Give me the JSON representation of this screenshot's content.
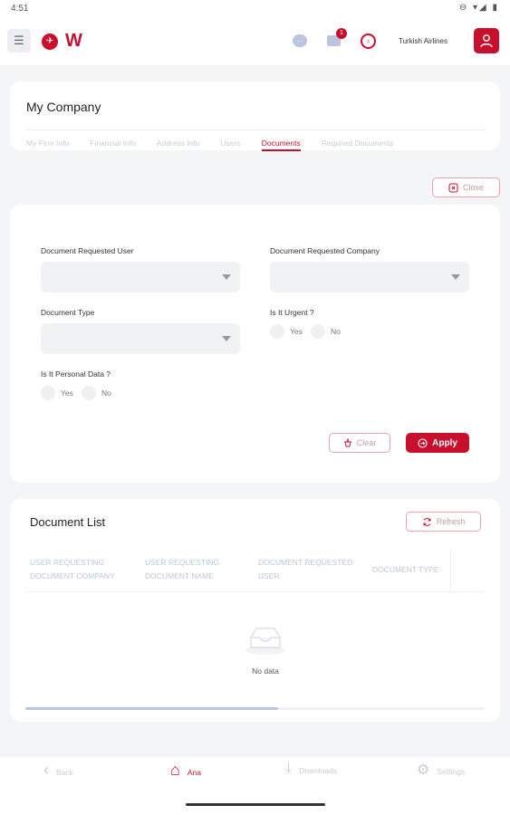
{
  "status": {
    "time": "4:51",
    "icons": "⊖ ▾◢ ▮"
  },
  "topbar": {
    "menu_icon": "☰",
    "logo_mark": "✈",
    "logo_text": "W",
    "chat_icon": "…",
    "notification_count": "1",
    "globe_icon": "♁",
    "company_name": "Turkish Airlines"
  },
  "company": {
    "title": "My Company",
    "tabs": [
      {
        "label": "My Firm Info"
      },
      {
        "label": "Financial Info"
      },
      {
        "label": "Address Info"
      },
      {
        "label": "Users"
      },
      {
        "label": "Documents"
      },
      {
        "label": "Required Documents"
      }
    ],
    "active_tab": "Documents"
  },
  "close_button": "Close",
  "filters": {
    "requested_user_label": "Document Requested User",
    "requested_company_label": "Document Requested Company",
    "type_label": "Document Type",
    "urgent_label": "Is It Urgent ?",
    "personal_label": "Is It Personal Data ?",
    "yes": "Yes",
    "no": "No",
    "clear_button": "Clear",
    "apply_button": "Apply"
  },
  "document_list": {
    "title": "Document List",
    "refresh_button": "Refresh",
    "columns": [
      {
        "line1": "USER REQUESTING",
        "line2": "DOCUMENT COMPANY"
      },
      {
        "line1": "USER REQUESTING",
        "line2": "DOCUMENT NAME"
      },
      {
        "line1": "DOCUMENT REQUESTED",
        "line2": "USER"
      },
      {
        "line1": "DOCUMENT TYPE",
        "line2": ""
      }
    ],
    "empty_text": "No data",
    "scroll_fraction": 0.55
  },
  "nav": {
    "items": [
      {
        "label": "Back",
        "icon": "‹"
      },
      {
        "label": "Ana",
        "icon": "⌂"
      },
      {
        "label": "Downloads",
        "icon": "⤓"
      },
      {
        "label": "Settings",
        "icon": "⚙"
      }
    ]
  },
  "colors": {
    "accent": "#c8102e",
    "background": "#f4f5f7",
    "muted": "#c7cdd6"
  }
}
